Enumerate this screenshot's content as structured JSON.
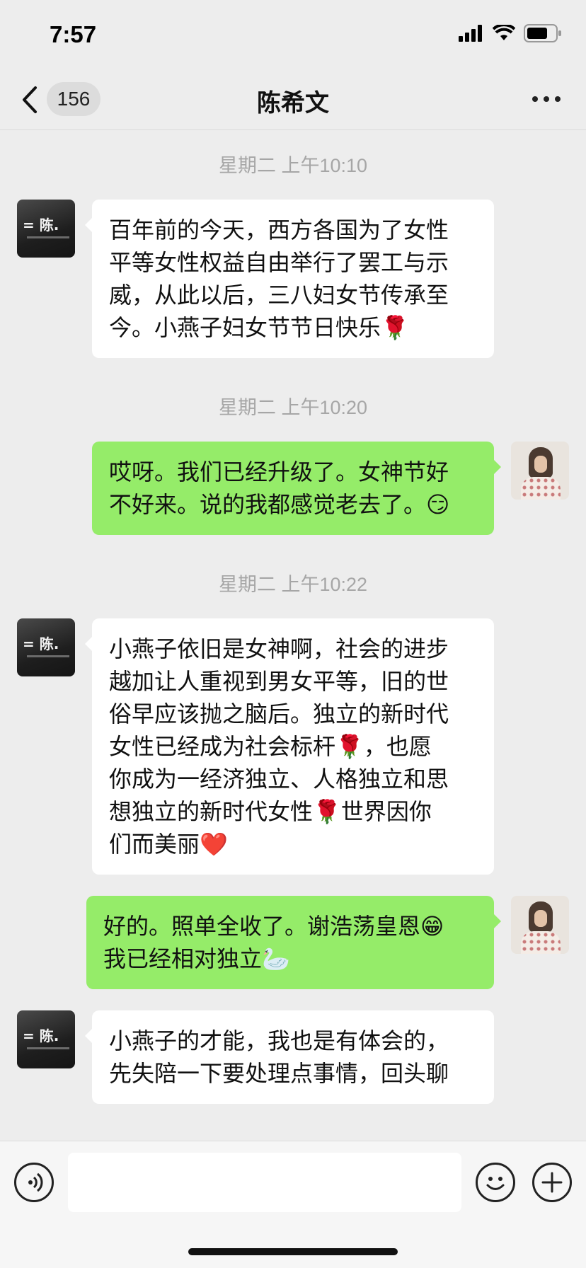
{
  "status_bar": {
    "time": "7:57",
    "icons": [
      "signal-icon",
      "wifi-icon",
      "battery-icon"
    ]
  },
  "nav": {
    "back_icon": "chevron-left-icon",
    "unread_count": "156",
    "title": "陈希文",
    "more_icon": "more-dots-icon"
  },
  "messages": [
    {
      "type": "timestamp",
      "text": "星期二 上午10:10"
    },
    {
      "type": "received",
      "sender": "陈希文",
      "lines": [
        "百年前的今天，西方各国为了女性",
        "平等女性权益自由举行了罢工与示",
        "威，从此以后，三八妇女节传承至",
        "今。小燕子妇女节节日快乐🌹"
      ]
    },
    {
      "type": "timestamp",
      "text": "星期二 上午10:20"
    },
    {
      "type": "sent",
      "lines": [
        "哎呀。我们已经升级了。女神节好",
        "不好来。说的我都感觉老去了。😏"
      ]
    },
    {
      "type": "timestamp",
      "text": "星期二 上午10:22"
    },
    {
      "type": "received",
      "sender": "陈希文",
      "lines": [
        "小燕子依旧是女神啊，社会的进步",
        "越加让人重视到男女平等，旧的世",
        "俗早应该抛之脑后。独立的新时代",
        "女性已经成为社会标杆🌹，也愿",
        "你成为一经济独立、人格独立和思",
        "想独立的新时代女性🌹世界因你",
        "们而美丽❤️"
      ]
    },
    {
      "type": "sent",
      "lines": [
        "好的。照单全收了。谢浩荡皇恩😁",
        "我已经相对独立🦢"
      ]
    },
    {
      "type": "received",
      "sender": "陈希文",
      "lines": [
        "小燕子的才能，我也是有体会的，",
        "先失陪一下要处理点事情，回头聊"
      ]
    }
  ],
  "input_bar": {
    "voice_icon": "voice-icon",
    "text_value": "",
    "emoji_icon": "smiley-icon",
    "plus_icon": "plus-icon"
  },
  "colors": {
    "background": "#ededed",
    "sent_bubble": "#95ec69",
    "received_bubble": "#ffffff"
  }
}
